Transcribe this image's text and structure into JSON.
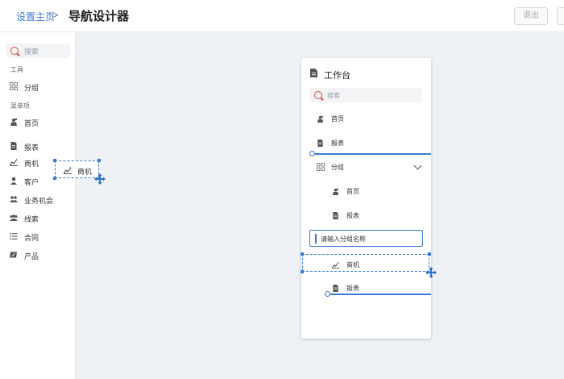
{
  "header": {
    "breadcrumb_home": "设置主页",
    "breadcrumb_separator": ">",
    "title": "导航设计器",
    "exit_label": "退出"
  },
  "left_panel": {
    "search_placeholder": "搜索",
    "tools_section": "工具",
    "tools": [
      {
        "label": "分组",
        "icon": "grid-icon"
      }
    ],
    "menu_section": "菜单项",
    "menu_items": [
      {
        "label": "首页",
        "icon": "home-icon"
      },
      {
        "label": "报表",
        "icon": "document-icon"
      },
      {
        "label": "商机",
        "icon": "chart-icon"
      },
      {
        "label": "客户",
        "icon": "user-icon"
      },
      {
        "label": "业务机会",
        "icon": "opportunity-icon"
      },
      {
        "label": "线索",
        "icon": "people-icon"
      },
      {
        "label": "合同",
        "icon": "list-icon"
      },
      {
        "label": "产品",
        "icon": "product-icon"
      }
    ],
    "dragging_label": "商机"
  },
  "preview": {
    "title": "工作台",
    "search_placeholder": "搜索",
    "items": [
      {
        "label": "首页",
        "icon": "home-icon"
      },
      {
        "label": "报表",
        "icon": "document-icon"
      }
    ],
    "group": {
      "label": "分组",
      "icon": "grid-icon",
      "children": [
        {
          "label": "首页",
          "icon": "home-icon"
        },
        {
          "label": "报表",
          "icon": "document-icon"
        }
      ],
      "name_placeholder": "请输入分组名称"
    },
    "dropped_item": {
      "label": "商机",
      "icon": "chart-icon"
    },
    "after_item": {
      "label": "报表",
      "icon": "document-icon"
    }
  },
  "colors": {
    "accent": "#3a7bd5",
    "search_icon": "#e04a3f",
    "canvas": "#eef1f6"
  }
}
